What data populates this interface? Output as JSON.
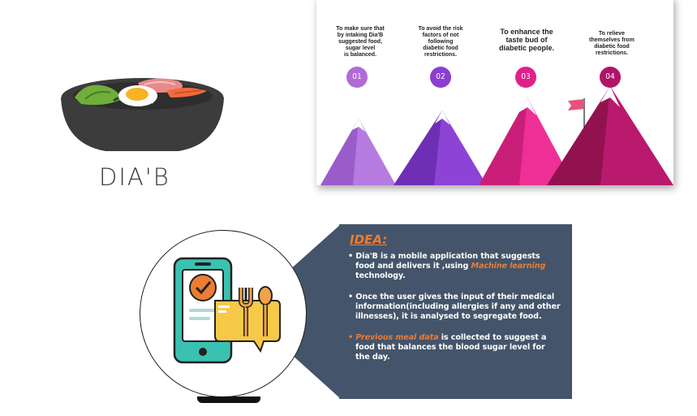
{
  "brand": {
    "name": "DIA'B",
    "logo_icon": "bibimbap-bowl-icon"
  },
  "goals": [
    {
      "number": "01",
      "lines": [
        "To make sure that",
        "by intaking Dia'B",
        "suggested food,",
        "sugar level",
        "is balanced."
      ],
      "color": "#b06ad9"
    },
    {
      "number": "02",
      "lines": [
        "To avoid the risk",
        "factors of not",
        "following",
        "diabetic food",
        "restrictions."
      ],
      "color": "#8a3fd0"
    },
    {
      "number": "03",
      "lines": [
        "To enhance the",
        "taste bud of",
        "diabetic people."
      ],
      "color": "#e0208a"
    },
    {
      "number": "04",
      "lines": [
        "To relieve",
        "themselves from",
        "diabetic food",
        "restrictions."
      ],
      "color": "#b01468"
    }
  ],
  "idea": {
    "title": "IDEA:",
    "icon": "phone-food-checkmark-icon",
    "points": [
      {
        "bullet": "•",
        "parts": [
          {
            "text": "Dia'B is a mobile application that suggests food and delivers it ,using ",
            "highlight": false
          },
          {
            "text": "Machine learning",
            "highlight": true
          },
          {
            "text": " technology.",
            "highlight": false
          }
        ]
      },
      {
        "bullet": "•",
        "parts": [
          {
            "text": "Once the user gives the input of their medical information(including allergies if any and other illnesses), it is analysed to segregate food.",
            "highlight": false
          }
        ]
      },
      {
        "bullet": "•",
        "parts": [
          {
            "text": "Previous meal data",
            "highlight": true
          },
          {
            "text": " is collected to suggest a food that balances the blood sugar level for the day.",
            "highlight": false
          }
        ]
      }
    ]
  },
  "colors": {
    "idea_bg": "#44546a",
    "accent": "#ed7d31"
  }
}
